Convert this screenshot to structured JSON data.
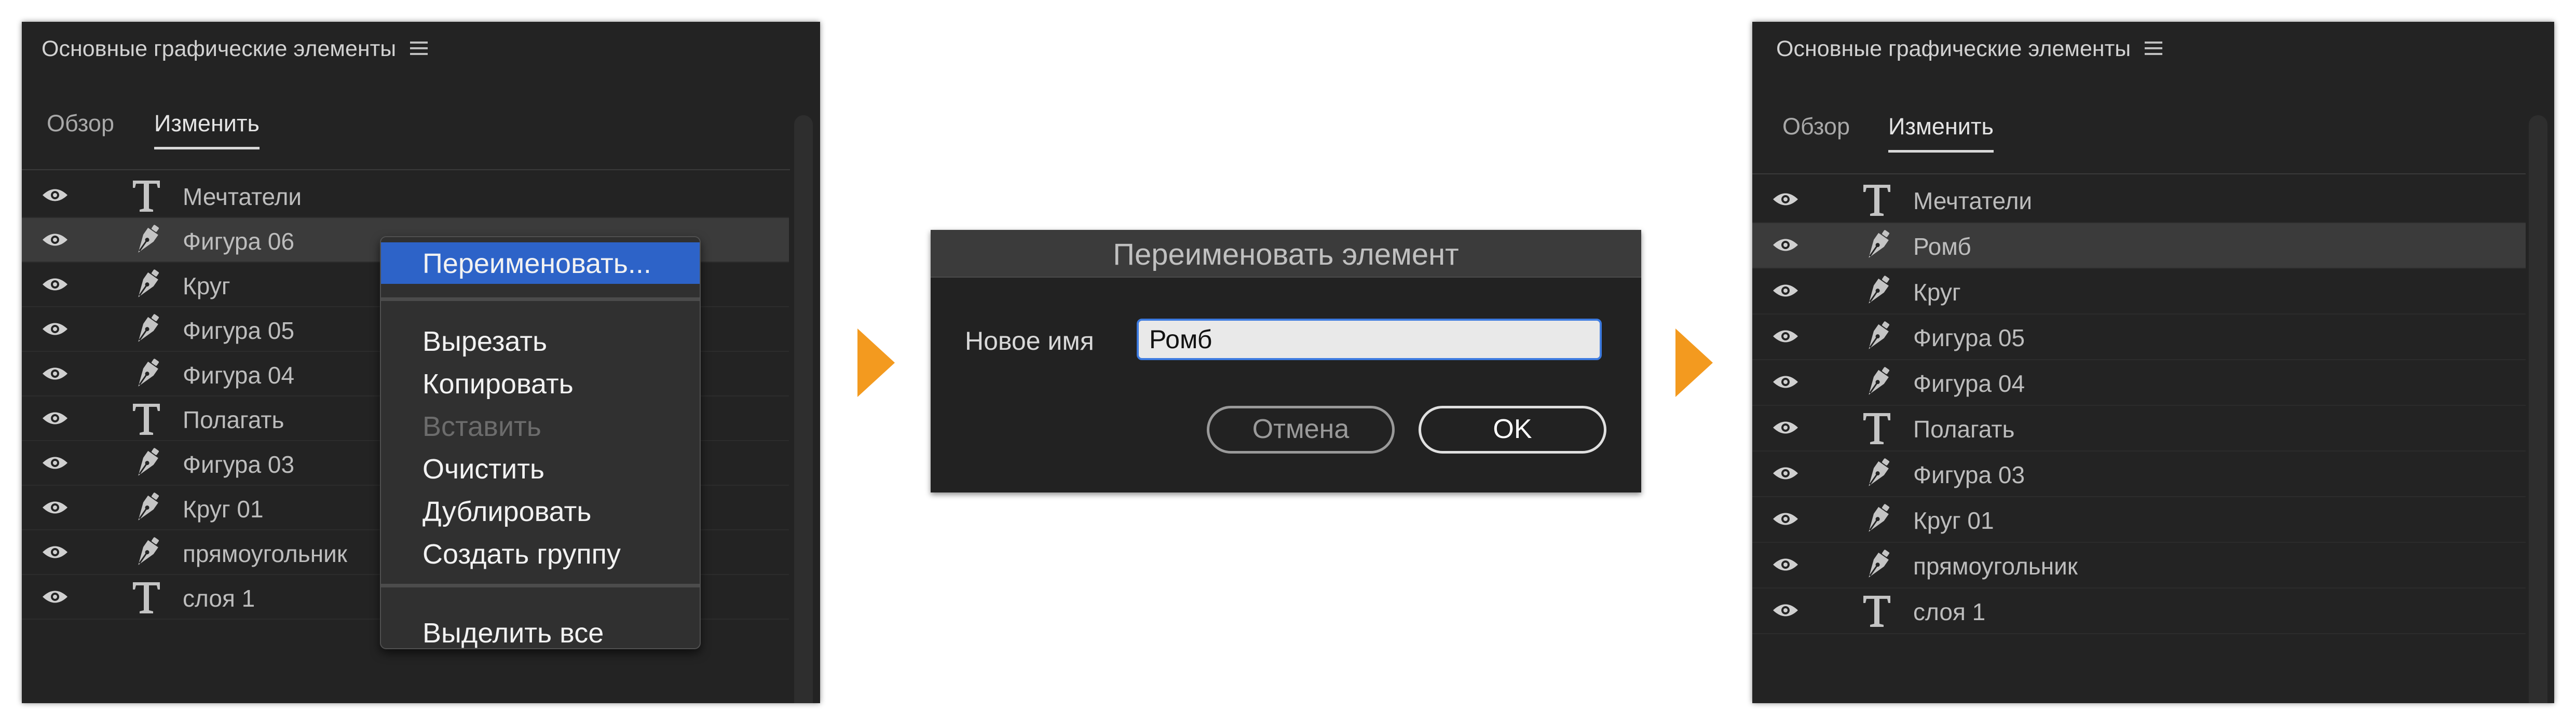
{
  "left_panel": {
    "title": "Основные графические элементы",
    "tabs": [
      {
        "label": "Обзор"
      },
      {
        "label": "Изменить"
      }
    ],
    "active_tab": 1,
    "selected_index": 1,
    "layers": [
      {
        "name": "Мечтатели",
        "type": "text"
      },
      {
        "name": "Фигура 06",
        "type": "shape"
      },
      {
        "name": "Круг",
        "type": "shape"
      },
      {
        "name": "Фигура 05",
        "type": "shape"
      },
      {
        "name": "Фигура 04",
        "type": "shape"
      },
      {
        "name": "Полагать",
        "type": "text"
      },
      {
        "name": "Фигура 03",
        "type": "shape"
      },
      {
        "name": "Круг 01",
        "type": "shape"
      },
      {
        "name": "прямоугольник",
        "type": "shape"
      },
      {
        "name": "слоя 1",
        "type": "text"
      }
    ]
  },
  "context_menu": {
    "items": [
      {
        "label": "Переименовать...",
        "highlighted": true,
        "disabled": false
      },
      {
        "label": "Вырезать",
        "highlighted": false,
        "disabled": false
      },
      {
        "label": "Копировать",
        "highlighted": false,
        "disabled": false
      },
      {
        "label": "Вставить",
        "highlighted": false,
        "disabled": true
      },
      {
        "label": "Очистить",
        "highlighted": false,
        "disabled": false
      },
      {
        "label": "Дублировать",
        "highlighted": false,
        "disabled": false
      },
      {
        "label": "Создать группу",
        "highlighted": false,
        "disabled": false
      },
      {
        "label": "Выделить все",
        "highlighted": false,
        "disabled": false
      }
    ]
  },
  "rename_dialog": {
    "title": "Переименовать элемент",
    "field_label": "Новое имя",
    "field_value": "Ромб",
    "cancel_label": "Отмена",
    "ok_label": "OK"
  },
  "right_panel": {
    "title": "Основные графические элементы",
    "tabs": [
      {
        "label": "Обзор"
      },
      {
        "label": "Изменить"
      }
    ],
    "active_tab": 1,
    "selected_index": 1,
    "layers": [
      {
        "name": "Мечтатели",
        "type": "text"
      },
      {
        "name": "Ромб",
        "type": "shape"
      },
      {
        "name": "Круг",
        "type": "shape"
      },
      {
        "name": "Фигура 05",
        "type": "shape"
      },
      {
        "name": "Фигура 04",
        "type": "shape"
      },
      {
        "name": "Полагать",
        "type": "text"
      },
      {
        "name": "Фигура 03",
        "type": "shape"
      },
      {
        "name": "Круг 01",
        "type": "shape"
      },
      {
        "name": "прямоугольник",
        "type": "shape"
      },
      {
        "name": "слоя 1",
        "type": "text"
      }
    ]
  },
  "colors": {
    "panel_bg": "#232323",
    "selected_row": "#3b3b3b",
    "menu_highlight": "#2d63c8",
    "arrow": "#f39a1f",
    "input_focus": "#3d7be0"
  },
  "icons": {
    "visibility": "eye-icon",
    "text_layer": "text-layer-icon",
    "shape_layer": "pen-tool-icon",
    "panel_menu": "hamburger-icon",
    "flow_arrow": "arrow-right-icon"
  }
}
